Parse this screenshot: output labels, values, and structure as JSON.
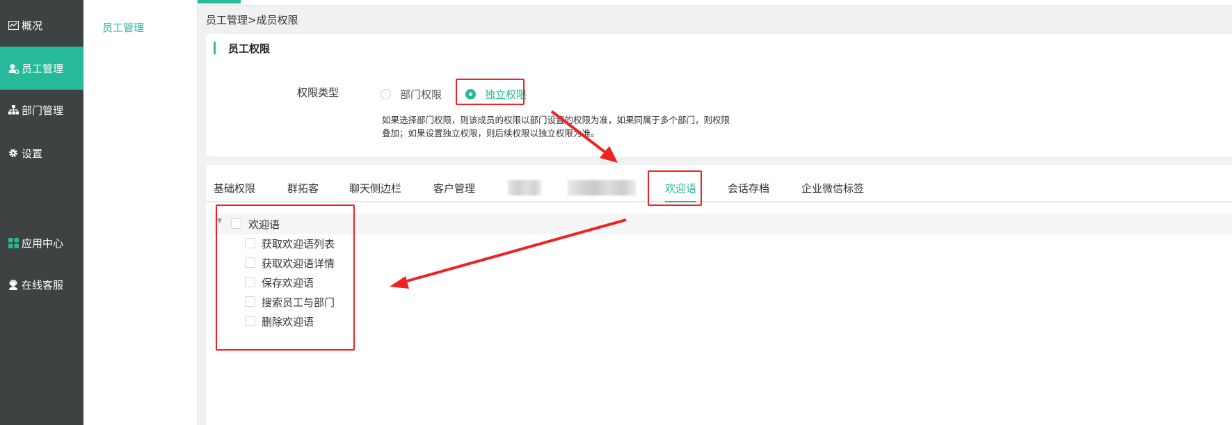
{
  "nav": {
    "items": [
      {
        "label": "概况",
        "icon": "chart-icon"
      },
      {
        "label": "员工管理",
        "icon": "user-manage-icon",
        "active": true
      },
      {
        "label": "部门管理",
        "icon": "org-tree-icon"
      },
      {
        "label": "设置",
        "icon": "gear-icon"
      },
      {
        "label": "应用中心",
        "icon": "apps-grid-icon"
      },
      {
        "label": "在线客服",
        "icon": "headset-icon"
      }
    ]
  },
  "submenu": {
    "label": "员工管理"
  },
  "breadcrumb": "员工管理>成员权限",
  "permission": {
    "title": "员工权限",
    "type_label": "权限类型",
    "options": [
      "部门权限",
      "独立权限"
    ],
    "selected": "独立权限",
    "hint_line1": "如果选择部门权限，则该成员的权限以部门设置的权限为准，如果同属于多个部门，则权限",
    "hint_line2": "叠加；如果设置独立权限，则后续权限以独立权限为准。"
  },
  "tabs": [
    "基础权限",
    "群拓客",
    "聊天侧边栏",
    "客户管理",
    "欢迎语",
    "会话存档",
    "企业微信标签"
  ],
  "active_tab": "欢迎语",
  "tree": {
    "root": "欢迎语",
    "children": [
      "获取欢迎语列表",
      "获取欢迎语详情",
      "保存欢迎语",
      "搜索员工与部门",
      "删除欢迎语"
    ]
  },
  "colors": {
    "accent": "#26b99a",
    "sidebar": "#3e4242",
    "annotation": "#ee2222"
  }
}
